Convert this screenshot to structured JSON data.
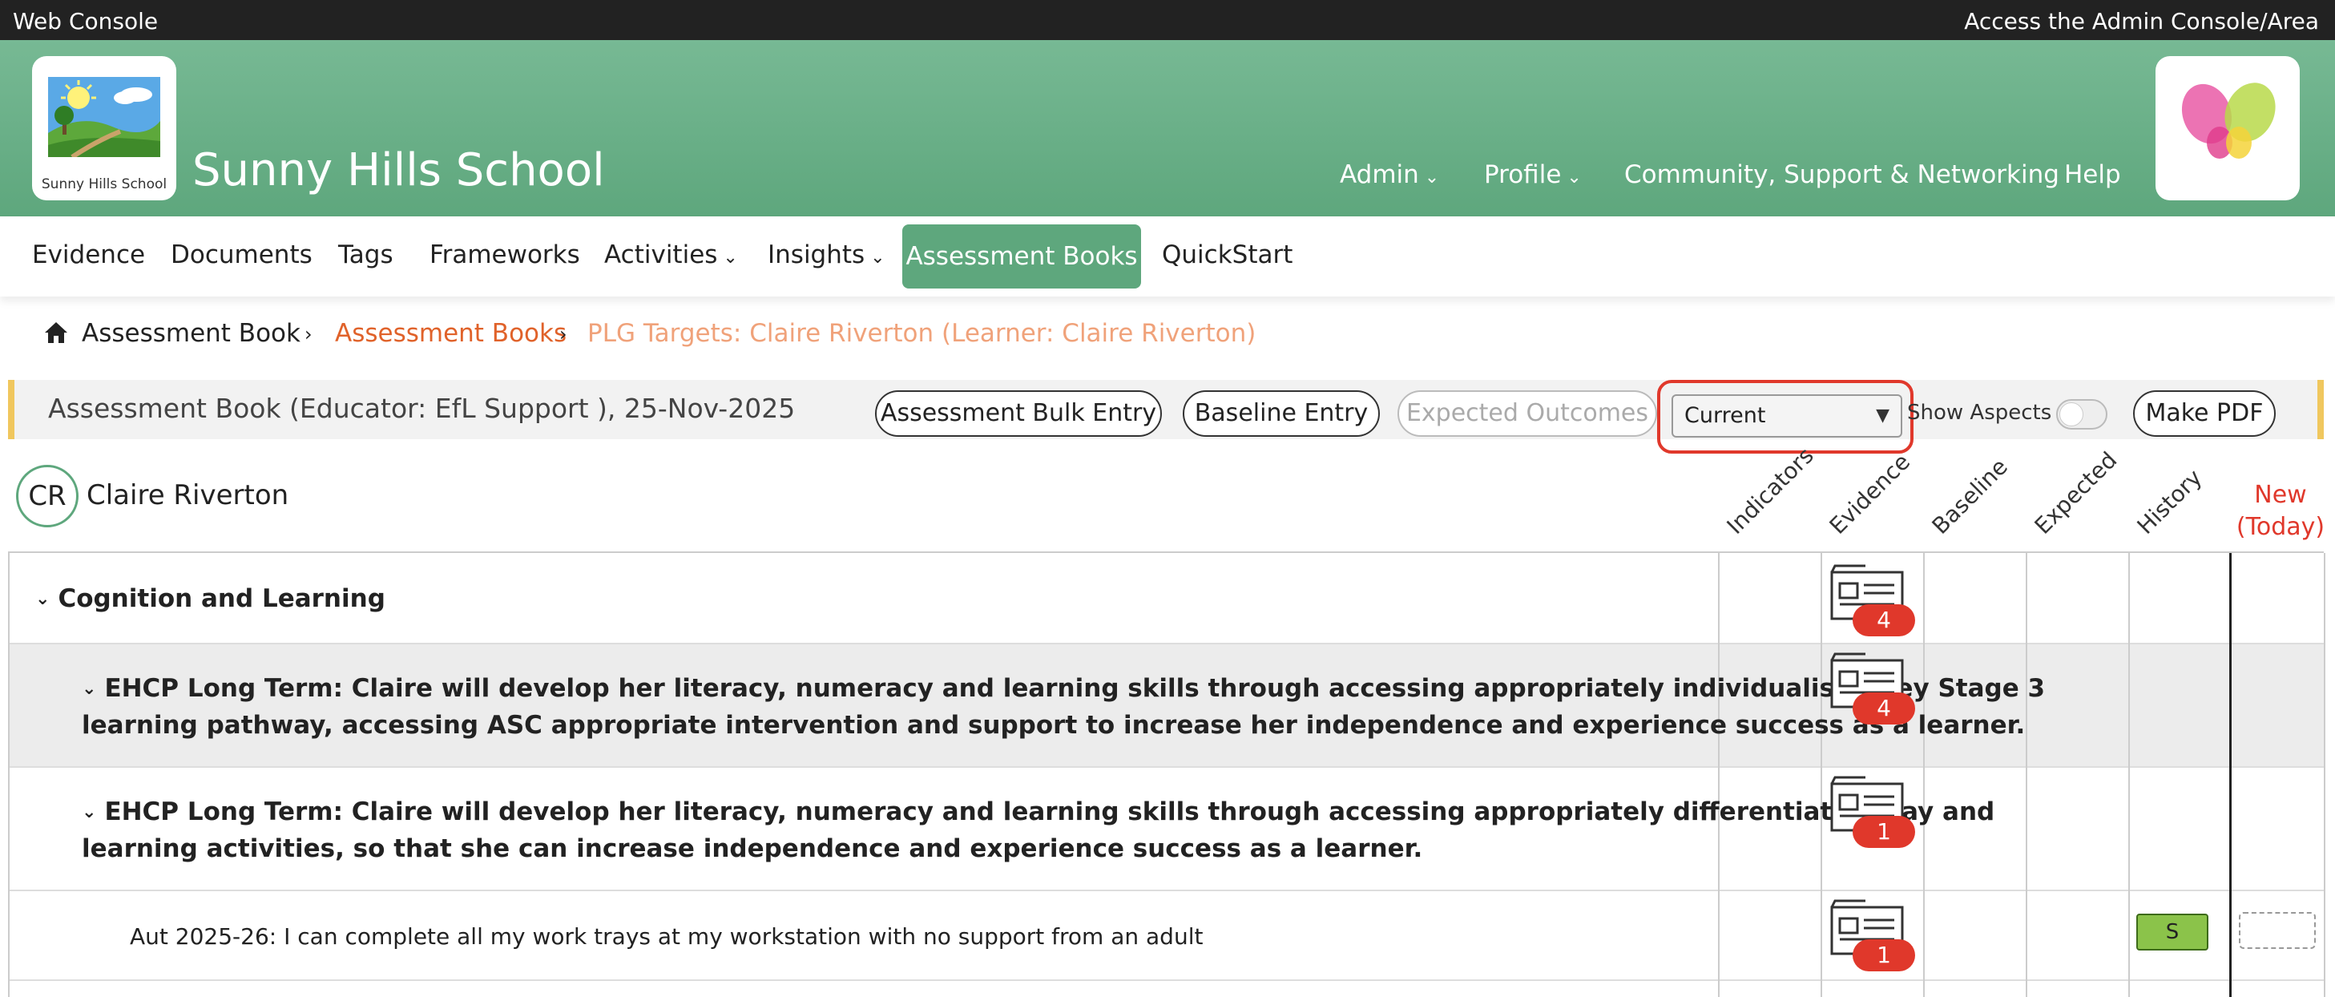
{
  "topbar": {
    "left": "Web Console",
    "right": "Access the Admin Console/Area"
  },
  "header": {
    "school_name": "Sunny Hills School",
    "logo_caption": "Sunny Hills School",
    "nav": [
      "Admin",
      "Profile",
      "Community, Support & Networking",
      "Help"
    ]
  },
  "mainnav": {
    "items": [
      "Evidence",
      "Documents",
      "Tags",
      "Frameworks",
      "Activities",
      "Insights",
      "Assessment Books",
      "QuickStart"
    ],
    "active": "Assessment Books"
  },
  "breadcrumb": {
    "home": "Assessment Book",
    "level2": "Assessment Books",
    "level3": "PLG Targets: Claire Riverton (Learner: Claire Riverton)"
  },
  "toolbar": {
    "title": "Assessment Book (Educator: EfL Support ), 25-Nov-2025",
    "bulk": "Assessment Bulk Entry",
    "baseline": "Baseline Entry",
    "expected": "Expected Outcomes",
    "select_value": "Current",
    "show_aspects": "Show Aspects",
    "pdf": "Make PDF"
  },
  "learner": {
    "initials": "CR",
    "name": "Claire Riverton"
  },
  "columns": [
    "Indicators",
    "Evidence",
    "Baseline",
    "Expected",
    "History"
  ],
  "new_column": {
    "line1": "New",
    "line2": "(Today)"
  },
  "rows": [
    {
      "text": "Cognition and Learning",
      "evidence": "4"
    },
    {
      "line1": "EHCP Long Term: Claire will develop her literacy, numeracy and learning skills through accessing appropriately individualised Key Stage 3",
      "line2": "learning pathway, accessing ASC appropriate intervention and support to increase her independence and experience success as a learner.",
      "evidence": "4"
    },
    {
      "line1": "EHCP Long Term: Claire will develop her literacy, numeracy and learning skills through accessing appropriately differentiated play and",
      "line2": "learning activities, so that she can increase independence and experience success as a learner.",
      "evidence": "1"
    },
    {
      "text": "Aut 2025-26: I can complete all my work trays at my workstation with no support from an adult",
      "evidence": "1",
      "history": "S"
    }
  ],
  "colors": {
    "accent_green": "#5ea77d",
    "link_orange": "#e0622a",
    "badge_red": "#e0382b",
    "band_yellow": "#f0c75e"
  }
}
